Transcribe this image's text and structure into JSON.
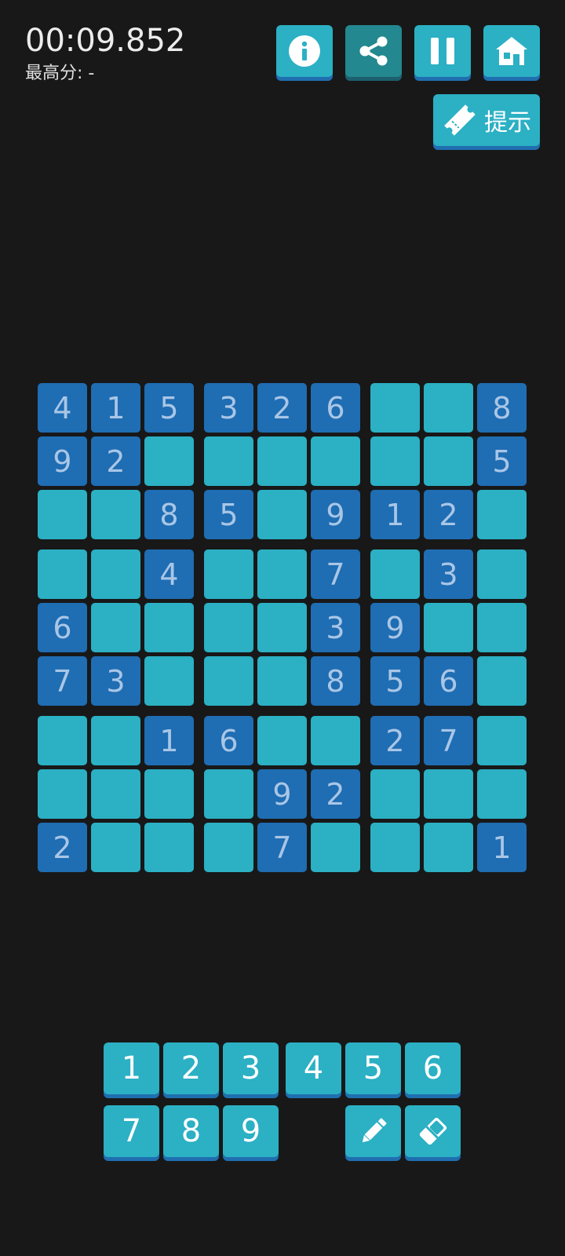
{
  "header": {
    "timer": "00:09.852",
    "best_score": "最高分: -"
  },
  "toolbar": {
    "info": {
      "icon": "info-icon"
    },
    "share": {
      "icon": "share-icon"
    },
    "pause": {
      "icon": "pause-icon"
    },
    "home": {
      "icon": "home-icon"
    },
    "hint": {
      "icon": "ticket-icon",
      "label": "提示"
    }
  },
  "board": {
    "rows": [
      [
        "4",
        "1",
        "5",
        "3",
        "2",
        "6",
        "",
        "",
        "8"
      ],
      [
        "9",
        "2",
        "",
        "",
        "",
        "",
        "",
        "",
        "5"
      ],
      [
        "",
        "",
        "8",
        "5",
        "",
        "9",
        "1",
        "2",
        ""
      ],
      [
        "",
        "",
        "4",
        "",
        "",
        "7",
        "",
        "3",
        ""
      ],
      [
        "6",
        "",
        "",
        "",
        "",
        "3",
        "9",
        "",
        ""
      ],
      [
        "7",
        "3",
        "",
        "",
        "",
        "8",
        "5",
        "6",
        ""
      ],
      [
        "",
        "",
        "1",
        "6",
        "",
        "",
        "2",
        "7",
        ""
      ],
      [
        "",
        "",
        "",
        "",
        "9",
        "2",
        "",
        "",
        ""
      ],
      [
        "2",
        "",
        "",
        "",
        "7",
        "",
        "",
        "",
        "1"
      ]
    ]
  },
  "keypad": {
    "numbers": [
      "1",
      "2",
      "3",
      "4",
      "5",
      "6",
      "7",
      "8",
      "9"
    ],
    "pencil": {
      "icon": "pencil-icon"
    },
    "eraser": {
      "icon": "eraser-icon"
    }
  },
  "colors": {
    "background": "#181818",
    "button": "#2bb0c4",
    "button_shadow": "#1f6fb0",
    "given_cell": "#1f6db3",
    "empty_cell": "#2bb0c4",
    "given_digit": "#a9c6e6"
  }
}
